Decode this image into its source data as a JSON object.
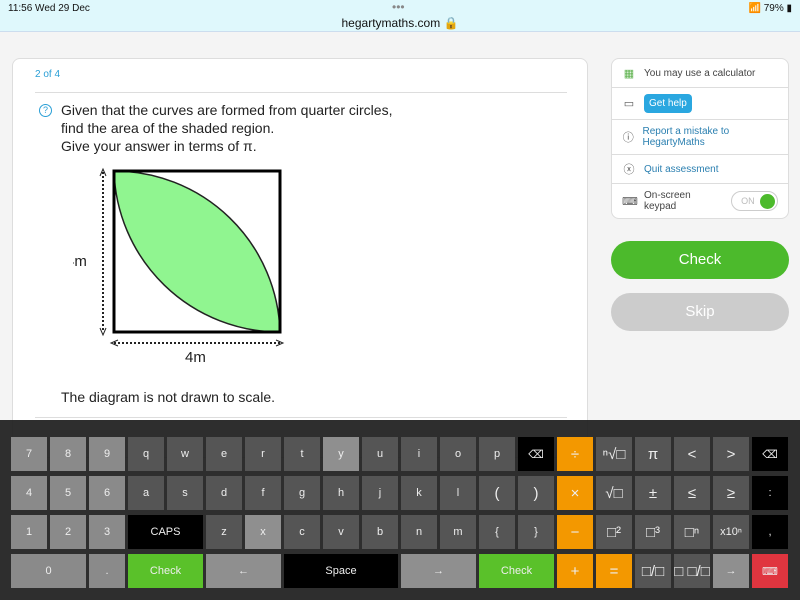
{
  "status": {
    "time": "11:56  Wed 29 Dec",
    "url": "hegartymaths.com 🔒",
    "battery": "79%"
  },
  "question": {
    "progress": "2 of 4",
    "lines": [
      "Given that the curves are formed from quarter circles,",
      "find the area of the shaded region.",
      "Give your answer in terms of π."
    ],
    "side_label": "4m",
    "bottom_label": "4m",
    "note": "The diagram is not drawn to scale.",
    "shade_color": "#90f590"
  },
  "sidebar": {
    "calculator": "You may use a calculator",
    "get_help": "Get help",
    "report": "Report a mistake to HegartyMaths",
    "quit": "Quit assessment",
    "keypad": "On-screen keypad",
    "keypad_state": "ON"
  },
  "buttons": {
    "check": "Check",
    "skip": "Skip"
  },
  "keyboard": [
    [
      [
        "7",
        "num"
      ],
      [
        "8",
        "num"
      ],
      [
        "9",
        "num"
      ],
      [
        "q",
        ""
      ],
      [
        "w",
        ""
      ],
      [
        "e",
        ""
      ],
      [
        "r",
        ""
      ],
      [
        "t",
        ""
      ],
      [
        "y",
        "light"
      ],
      [
        "u",
        ""
      ],
      [
        "i",
        ""
      ],
      [
        "o",
        ""
      ],
      [
        "p",
        ""
      ],
      [
        "⌫",
        "black"
      ],
      [
        "÷",
        "orange"
      ],
      [
        "ⁿ√□",
        "sym"
      ],
      [
        "π",
        "sym"
      ],
      [
        "<",
        "sym"
      ],
      [
        ">",
        "sym"
      ],
      [
        "⌫",
        "black"
      ]
    ],
    [
      [
        "4",
        "num"
      ],
      [
        "5",
        "num"
      ],
      [
        "6",
        "num"
      ],
      [
        "a",
        ""
      ],
      [
        "s",
        ""
      ],
      [
        "d",
        ""
      ],
      [
        "f",
        ""
      ],
      [
        "g",
        ""
      ],
      [
        "h",
        ""
      ],
      [
        "j",
        ""
      ],
      [
        "k",
        ""
      ],
      [
        "l",
        ""
      ],
      [
        "(",
        "sym"
      ],
      [
        ")",
        "sym"
      ],
      [
        "×",
        "orange"
      ],
      [
        "√□",
        "sym"
      ],
      [
        "±",
        "sym"
      ],
      [
        "≤",
        "sym"
      ],
      [
        "≥",
        "sym"
      ],
      [
        ":",
        "black"
      ]
    ],
    [
      [
        "1",
        "num"
      ],
      [
        "2",
        "num"
      ],
      [
        "3",
        "num"
      ],
      [
        "CAPS",
        "black"
      ],
      [
        "z",
        ""
      ],
      [
        "x",
        "light"
      ],
      [
        "c",
        ""
      ],
      [
        "v",
        ""
      ],
      [
        "b",
        ""
      ],
      [
        "n",
        ""
      ],
      [
        "m",
        ""
      ],
      [
        "{",
        ""
      ],
      [
        "}",
        ""
      ],
      [
        "−",
        "orange"
      ],
      [
        "□²",
        "sym"
      ],
      [
        "□³",
        "sym"
      ],
      [
        "□ⁿ",
        "sym"
      ],
      [
        "x10ⁿ",
        ""
      ],
      [
        ",",
        "black"
      ]
    ],
    [
      [
        "0",
        "num"
      ],
      [
        ".",
        "num"
      ],
      [
        "Check",
        "green"
      ],
      [
        "←",
        "light"
      ],
      [
        "Space",
        "black"
      ],
      [
        "→",
        "light"
      ],
      [
        "Check",
        "green"
      ],
      [
        "+",
        "orange"
      ],
      [
        "=",
        "orange"
      ],
      [
        "□/□",
        "sym"
      ],
      [
        "□ □/□",
        "sym"
      ],
      [
        "→",
        "light"
      ],
      [
        "⌨",
        "red"
      ]
    ]
  ]
}
